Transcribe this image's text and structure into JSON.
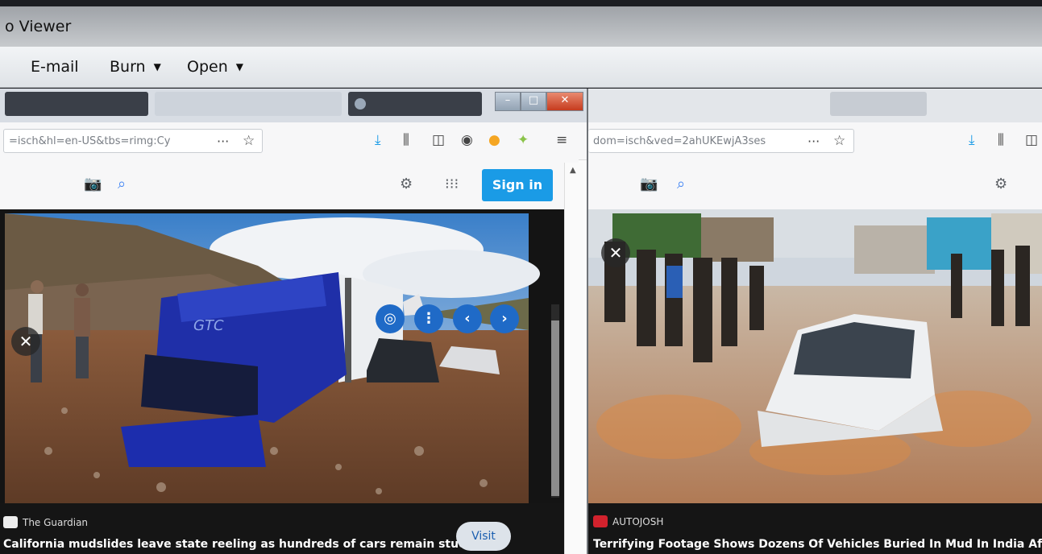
{
  "app": {
    "title": "o Viewer",
    "menu": [
      {
        "label": "E-mail"
      },
      {
        "label": "Burn"
      },
      {
        "label": "Open"
      }
    ]
  },
  "left_browser": {
    "url": "=isch&hl=en-US&tbs=rimg:Cy",
    "signin_label": "Sign in",
    "image_source": "The Guardian",
    "image_caption": "California mudslides leave state reeling as hundreds of cars remain stuc...",
    "visit_label": "Visit",
    "truck_text": "GTC"
  },
  "right_browser": {
    "url": "dom=isch&ved=2ahUKEwjA3ses",
    "image_source": "AUTOJOSH",
    "image_caption": "Terrifying Footage Shows Dozens Of Vehicles Buried In Mud In India Aft..."
  },
  "colors": {
    "accent_blue": "#1a9be6",
    "lens_button_blue": "#1f6ac7"
  },
  "icons": {
    "toolbar": [
      "more-icon",
      "star-icon",
      "download-icon",
      "library-icon",
      "sidebar-icon",
      "account-icon",
      "addon-icon",
      "extension-icon",
      "menu-icon"
    ],
    "page": [
      "camera-icon",
      "search-icon",
      "settings-icon",
      "apps-icon"
    ],
    "image": [
      "lens-icon",
      "more-vert-icon",
      "prev-icon",
      "next-icon",
      "close-icon"
    ]
  }
}
